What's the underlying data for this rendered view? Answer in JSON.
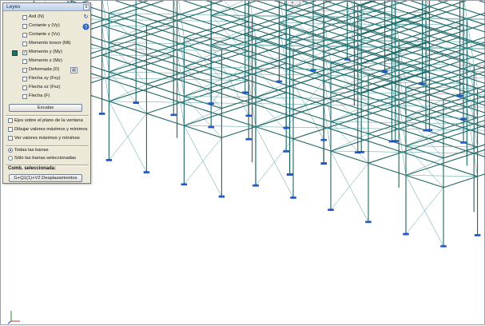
{
  "window": {
    "title": "Leyes",
    "close_glyph": "x",
    "top_handle_glyph": "▪"
  },
  "laws": {
    "items": [
      {
        "label": "Axil (N)",
        "checked": false
      },
      {
        "label": "Cortante y (Vy)",
        "checked": false
      },
      {
        "label": "Cortante z (Vz)",
        "checked": false
      },
      {
        "label": "Momento torsor (Mt)",
        "checked": false
      },
      {
        "label": "Momento y (My)",
        "checked": true
      },
      {
        "label": "Momento z (Mz)",
        "checked": false
      },
      {
        "label": "Deformada (D)",
        "checked": false
      },
      {
        "label": "Flecha xy (Fxy)",
        "checked": false
      },
      {
        "label": "Flecha xz (Fxz)",
        "checked": false
      },
      {
        "label": "Flecha (F)",
        "checked": false
      }
    ],
    "active_color": "#1f6f6f"
  },
  "scales_button": "Escalas",
  "options": {
    "axes_on_window_plane": "Ejes sobre el plano de la ventana",
    "draw_max_min": "Dibujar valores máximos y mínimos",
    "show_max_min": "Ver valores máximos y mínimos"
  },
  "bars": {
    "all_bars": "Todas las barras",
    "selected_bars": "Sólo las barras seleccionadas"
  },
  "combination": {
    "label": "Comb. seleccionada:",
    "value": "G+Q1(1)+V2 Desplazamientos"
  },
  "icons": {
    "refresh": "refresh-icon",
    "help": "help-icon",
    "support": "support-icon"
  },
  "colors": {
    "structure": "#1e6565",
    "bracing": "#2f8d8d",
    "support": "#1f5bd6",
    "panel_bg": "#ece9d8"
  }
}
